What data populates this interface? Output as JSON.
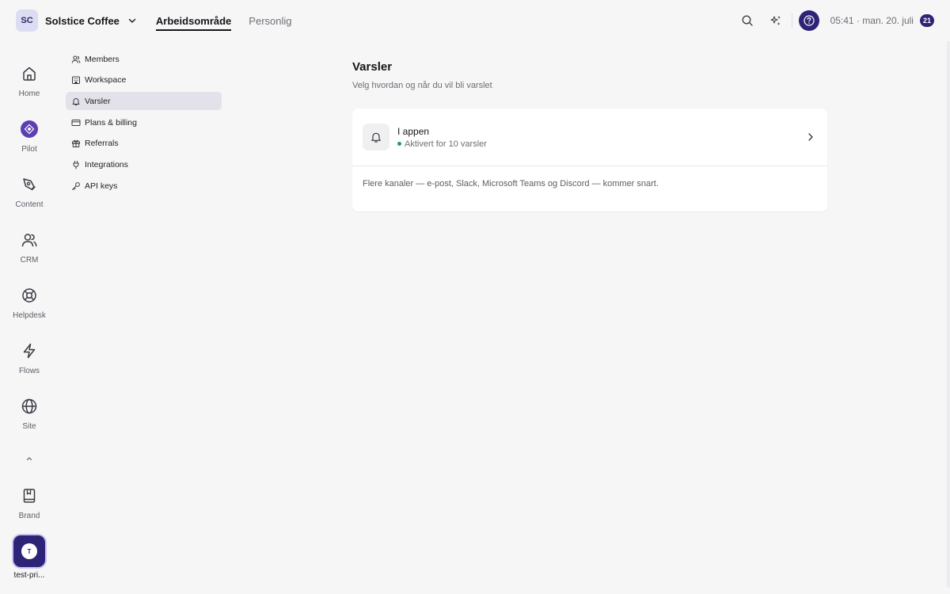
{
  "topbar": {
    "workspace_initials": "SC",
    "workspace_name": "Solstice Coffee",
    "tabs": [
      {
        "label": "Arbeidsområde",
        "active": true
      },
      {
        "label": "Personlig",
        "active": false
      }
    ],
    "clock": "05:41 · man. 20. juli",
    "badge_count": "21"
  },
  "rail": {
    "items": [
      {
        "label": "Home",
        "icon": "home-icon"
      },
      {
        "label": "Pilot",
        "icon": "pilot-icon"
      },
      {
        "label": "Content",
        "icon": "pen-icon"
      },
      {
        "label": "CRM",
        "icon": "users-icon"
      },
      {
        "label": "Helpdesk",
        "icon": "lifebuoy-icon"
      },
      {
        "label": "Flows",
        "icon": "lightning-icon"
      },
      {
        "label": "Site",
        "icon": "globe-icon"
      }
    ],
    "brand_label": "Brand",
    "user_initial": "T",
    "user_label": "test-pri..."
  },
  "settings_nav": {
    "items": [
      {
        "label": "Members",
        "icon": "members-icon",
        "active": false
      },
      {
        "label": "Workspace",
        "icon": "building-icon",
        "active": false
      },
      {
        "label": "Varsler",
        "icon": "bell-icon",
        "active": true
      },
      {
        "label": "Plans & billing",
        "icon": "card-icon",
        "active": false
      },
      {
        "label": "Referrals",
        "icon": "gift-icon",
        "active": false
      },
      {
        "label": "Integrations",
        "icon": "plug-icon",
        "active": false
      },
      {
        "label": "API keys",
        "icon": "key-icon",
        "active": false
      }
    ]
  },
  "main": {
    "title": "Varsler",
    "subtitle": "Velg hvordan og når du vil bli varslet",
    "card": {
      "row_title": "I appen",
      "row_status": "Aktivert for 10 varsler",
      "note": "Flere kanaler — e-post, Slack, Microsoft Teams og Discord — kommer snart."
    }
  },
  "colors": {
    "accent": "#2e2477",
    "status_active": "#1f9d63"
  }
}
